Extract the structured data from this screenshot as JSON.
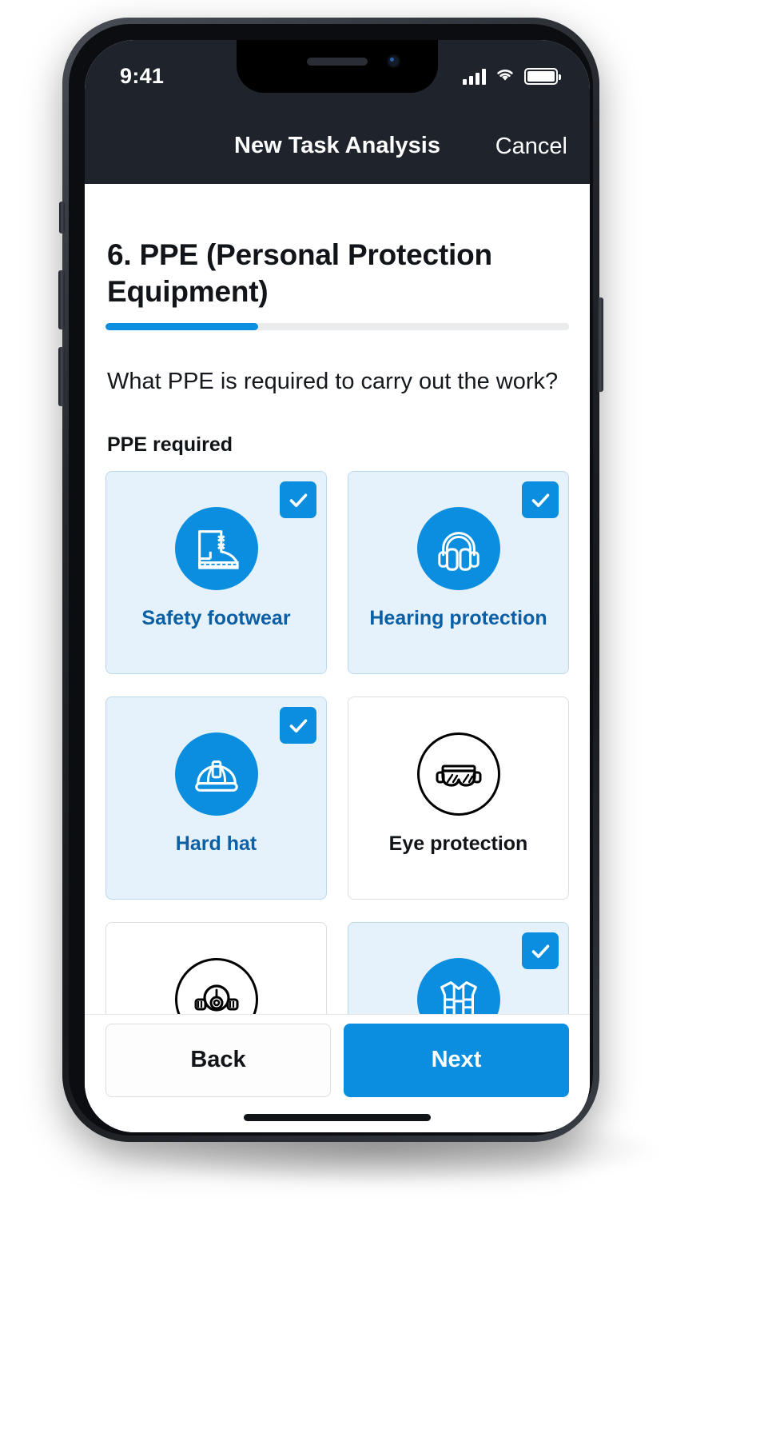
{
  "status_bar": {
    "time": "9:41",
    "cellular_icon": "signal-bars-icon",
    "wifi_icon": "wifi-icon",
    "battery_icon": "battery-full-icon"
  },
  "nav": {
    "title": "New Task Analysis",
    "cancel_label": "Cancel"
  },
  "form": {
    "step_title": "6. PPE (Personal Protection Equipment)",
    "progress_percent": 33,
    "question": "What PPE is required to carry out the work?",
    "field_label": "PPE required"
  },
  "ppe_options": [
    {
      "label": "Safety footwear",
      "icon": "safety-boot-icon",
      "selected": true,
      "check_icon": "checkmark-icon"
    },
    {
      "label": "Hearing protection",
      "icon": "ear-defenders-icon",
      "selected": true,
      "check_icon": "checkmark-icon"
    },
    {
      "label": "Hard hat",
      "icon": "hard-hat-icon",
      "selected": true,
      "check_icon": "checkmark-icon"
    },
    {
      "label": "Eye protection",
      "icon": "safety-goggles-icon",
      "selected": false,
      "check_icon": ""
    },
    {
      "label": "",
      "icon": "respirator-mask-icon",
      "selected": false,
      "check_icon": ""
    },
    {
      "label": "",
      "icon": "hi-vis-vest-icon",
      "selected": true,
      "check_icon": "checkmark-icon"
    }
  ],
  "footer": {
    "back_label": "Back",
    "next_label": "Next"
  },
  "colors": {
    "accent": "#0b8ee0",
    "selected_card_bg": "#e6f2fb",
    "selected_label": "#0b5fa5",
    "nav_bg": "#1f242c",
    "progress_track": "#e9ebed"
  }
}
